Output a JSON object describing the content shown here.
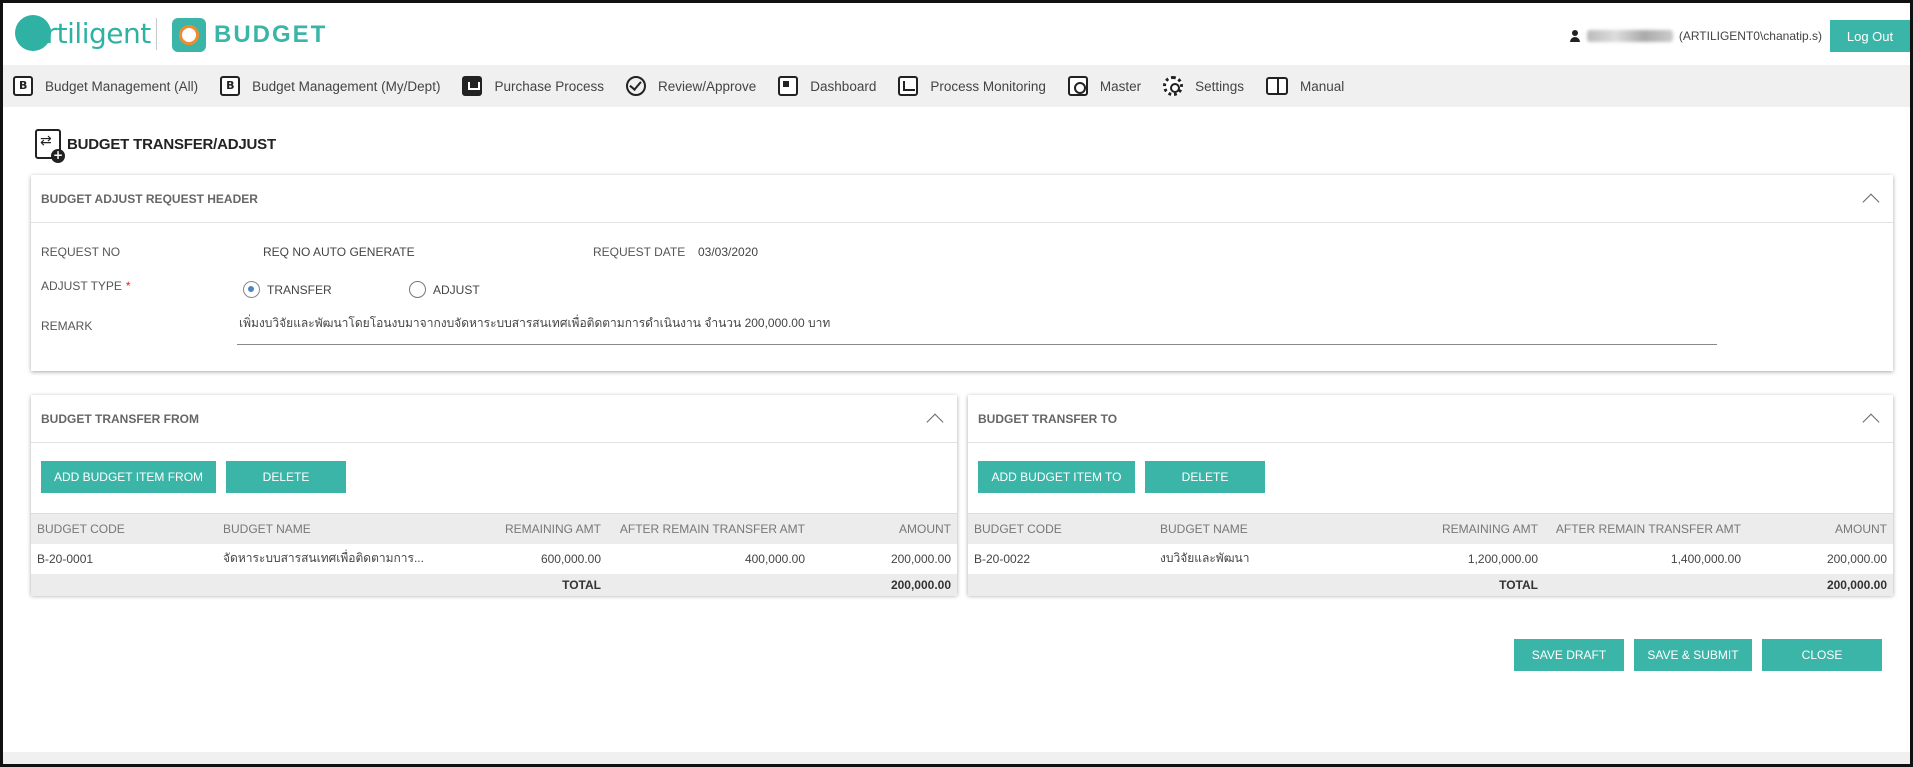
{
  "brand": {
    "company": "artiligent",
    "app": "BUDGET"
  },
  "user": {
    "display": "(ARTILIGENT0\\chanatip.s)",
    "logout_label": "Log Out"
  },
  "nav": [
    {
      "label": "Budget Management (All)",
      "icon": "budget-all-icon"
    },
    {
      "label": "Budget Management (My/Dept)",
      "icon": "budget-dept-icon"
    },
    {
      "label": "Purchase Process",
      "icon": "purchase-icon"
    },
    {
      "label": "Review/Approve",
      "icon": "check-circle-icon"
    },
    {
      "label": "Dashboard",
      "icon": "dashboard-icon"
    },
    {
      "label": "Process Monitoring",
      "icon": "monitoring-icon"
    },
    {
      "label": "Master",
      "icon": "safe-icon"
    },
    {
      "label": "Settings",
      "icon": "gear-icon"
    },
    {
      "label": "Manual",
      "icon": "book-icon"
    }
  ],
  "page": {
    "title": "BUDGET TRANSFER/ADJUST"
  },
  "header_panel": {
    "title": "BUDGET ADJUST REQUEST HEADER",
    "request_no_label": "REQUEST NO",
    "request_no_value": "REQ NO AUTO GENERATE",
    "request_date_label": "REQUEST DATE",
    "request_date_value": "03/03/2020",
    "adjust_type_label": "ADJUST TYPE",
    "required_mark": "*",
    "options": [
      {
        "label": "TRANSFER",
        "selected": true
      },
      {
        "label": "ADJUST",
        "selected": false
      }
    ],
    "remark_label": "REMARK",
    "remark_value": "เพิ่มงบวิจัยและพัฒนาโดยโอนงบมาจากงบจัดหาระบบสารสนเทศเพื่อติดตามการดำเนินงาน จำนวน 200,000.00 บาท"
  },
  "transfer_from": {
    "title": "BUDGET TRANSFER FROM",
    "add_label": "ADD BUDGET ITEM FROM",
    "delete_label": "DELETE",
    "columns": [
      "BUDGET CODE",
      "BUDGET NAME",
      "REMAINING AMT",
      "AFTER REMAIN TRANSFER AMT",
      "AMOUNT"
    ],
    "rows": [
      {
        "code": "B-20-0001",
        "name": "จัดหาระบบสารสนเทศเพื่อติดตามการ...",
        "remaining": "600,000.00",
        "after": "400,000.00",
        "amount": "200,000.00"
      }
    ],
    "total_label": "TOTAL",
    "total_amount": "200,000.00"
  },
  "transfer_to": {
    "title": "BUDGET TRANSFER TO",
    "add_label": "ADD BUDGET ITEM TO",
    "delete_label": "DELETE",
    "columns": [
      "BUDGET CODE",
      "BUDGET NAME",
      "REMAINING AMT",
      "AFTER REMAIN TRANSFER AMT",
      "AMOUNT"
    ],
    "rows": [
      {
        "code": "B-20-0022",
        "name": "งบวิจัยและพัฒนา",
        "remaining": "1,200,000.00",
        "after": "1,400,000.00",
        "amount": "200,000.00"
      }
    ],
    "total_label": "TOTAL",
    "total_amount": "200,000.00"
  },
  "actions": {
    "save_draft": "SAVE DRAFT",
    "save_submit": "SAVE & SUBMIT",
    "close": "CLOSE"
  },
  "colors": {
    "accent": "#3bb5a8",
    "brand_orange": "#f28b30",
    "nav_bg": "#f0f0f0"
  }
}
